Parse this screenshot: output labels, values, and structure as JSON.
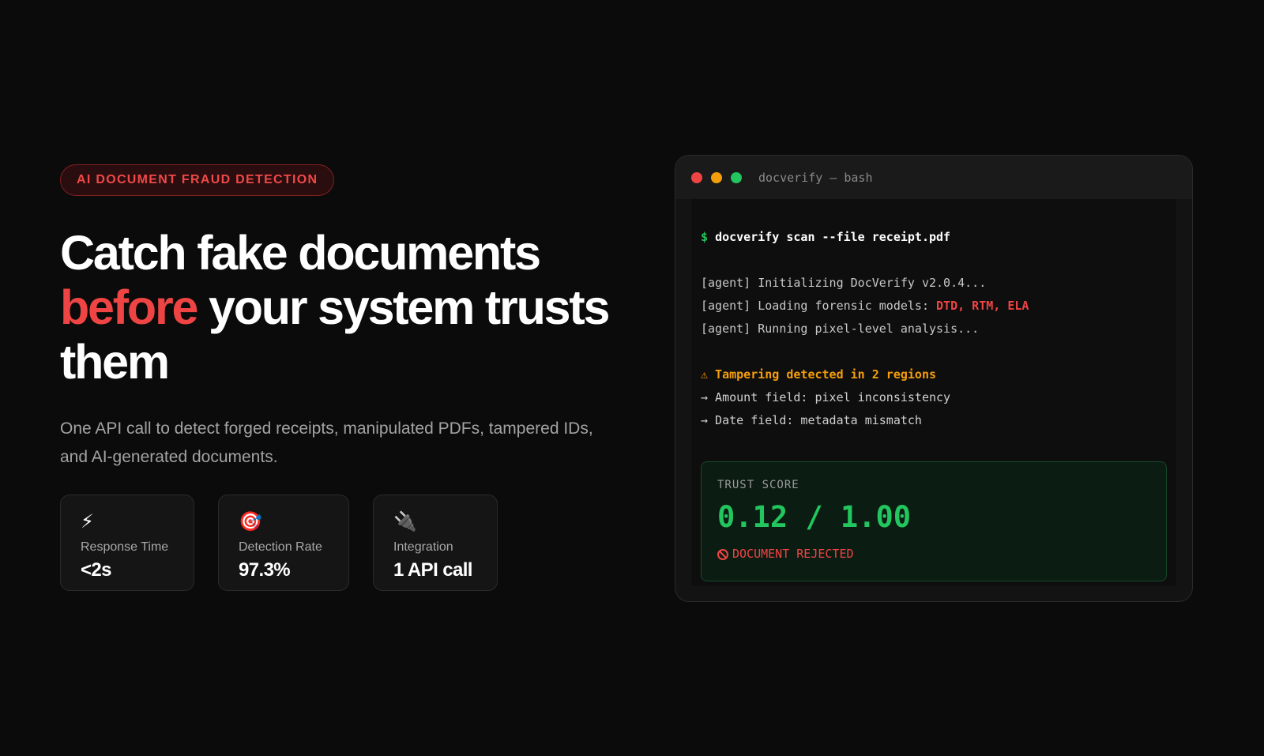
{
  "hero": {
    "badge": "AI DOCUMENT FRAUD DETECTION",
    "headline_line1": "Catch fake documents",
    "headline_accent": "before",
    "headline_line2_rest": " your system trusts",
    "headline_line3": "them",
    "subtitle": "One API call to detect forged receipts, manipulated PDFs, tampered IDs, and AI-generated documents."
  },
  "stats": [
    {
      "icon": "⚡",
      "icon_name": "lightning-icon",
      "label": "Response Time",
      "value": "<2s"
    },
    {
      "icon": "🎯",
      "icon_name": "target-icon",
      "label": "Detection Rate",
      "value": "97.3%"
    },
    {
      "icon": "🔌",
      "icon_name": "plug-icon",
      "label": "Integration",
      "value": "1 API call"
    }
  ],
  "terminal": {
    "title": "docverify — bash",
    "prompt": "$",
    "command": "docverify scan --file receipt.pdf",
    "log_init": "[agent] Initializing DocVerify v2.0.4...",
    "log_models_prefix": "[agent] Loading forensic models: ",
    "log_models_list": "DTD, RTM, ELA",
    "log_analysis": "[agent] Running pixel-level analysis...",
    "warning": "⚠ Tampering detected in 2 regions",
    "finding_1": "→ Amount field: pixel inconsistency",
    "finding_2": "→ Date field: metadata mismatch",
    "trust": {
      "label": "TRUST SCORE",
      "score": "0.12 / 1.00",
      "status": "DOCUMENT REJECTED"
    }
  },
  "colors": {
    "background": "#0b0b0b",
    "accent_red": "#ef4444",
    "accent_green": "#22c55e",
    "accent_amber": "#f59e0b"
  }
}
